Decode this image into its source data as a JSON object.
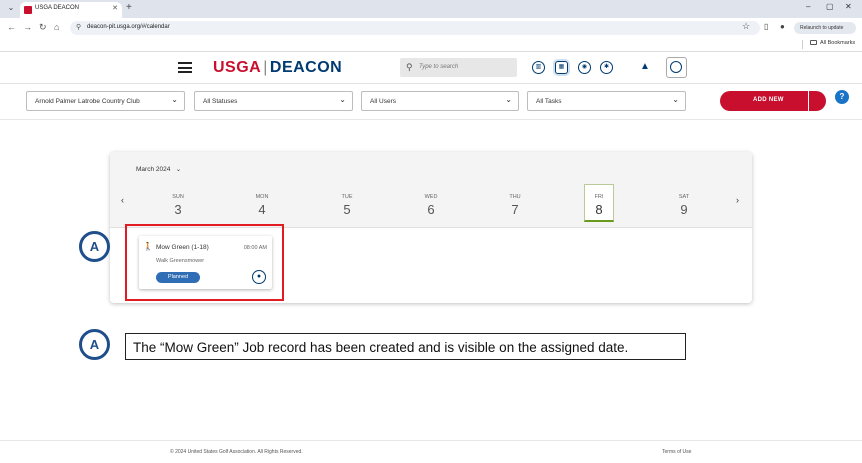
{
  "browser": {
    "tab_title": "USGA DEACON",
    "url": "deacon-pit.usga.org/#/calendar",
    "relaunch_label": "Relaunch to update",
    "bookmarks_label": "All Bookmarks"
  },
  "header": {
    "logo_usga": "USGA",
    "logo_sep": "|",
    "logo_deacon": "DEACON",
    "search_placeholder": "Type to search"
  },
  "filters": {
    "course": "Arnold Palmer Latrobe Country Club",
    "status": "All Statuses",
    "users": "All Users",
    "tasks": "All Tasks",
    "add_new": "ADD NEW"
  },
  "calendar": {
    "month": "March 2024",
    "days": [
      {
        "name": "SUN",
        "date": "3"
      },
      {
        "name": "MON",
        "date": "4"
      },
      {
        "name": "TUE",
        "date": "5"
      },
      {
        "name": "WED",
        "date": "6"
      },
      {
        "name": "THU",
        "date": "7"
      },
      {
        "name": "FRI",
        "date": "8"
      },
      {
        "name": "SAT",
        "date": "9"
      }
    ],
    "selected_day": "FRI"
  },
  "job": {
    "title": "Mow Green (1-18)",
    "time": "08:00 AM",
    "equipment": "Walk Greensmower",
    "status": "Planned"
  },
  "annotations": {
    "marker_1": "A",
    "marker_2": "A",
    "callout": "The “Mow Green” Job record has been created and is visible on the assigned date."
  },
  "footer": {
    "copyright": "© 2024 United States Golf Association. All Rights Reserved.",
    "terms": "Terms of Use"
  },
  "colors": {
    "brand_red": "#c8102e",
    "brand_navy": "#003a70",
    "status_blue": "#2f6db5",
    "highlight_red": "#e31b23"
  }
}
